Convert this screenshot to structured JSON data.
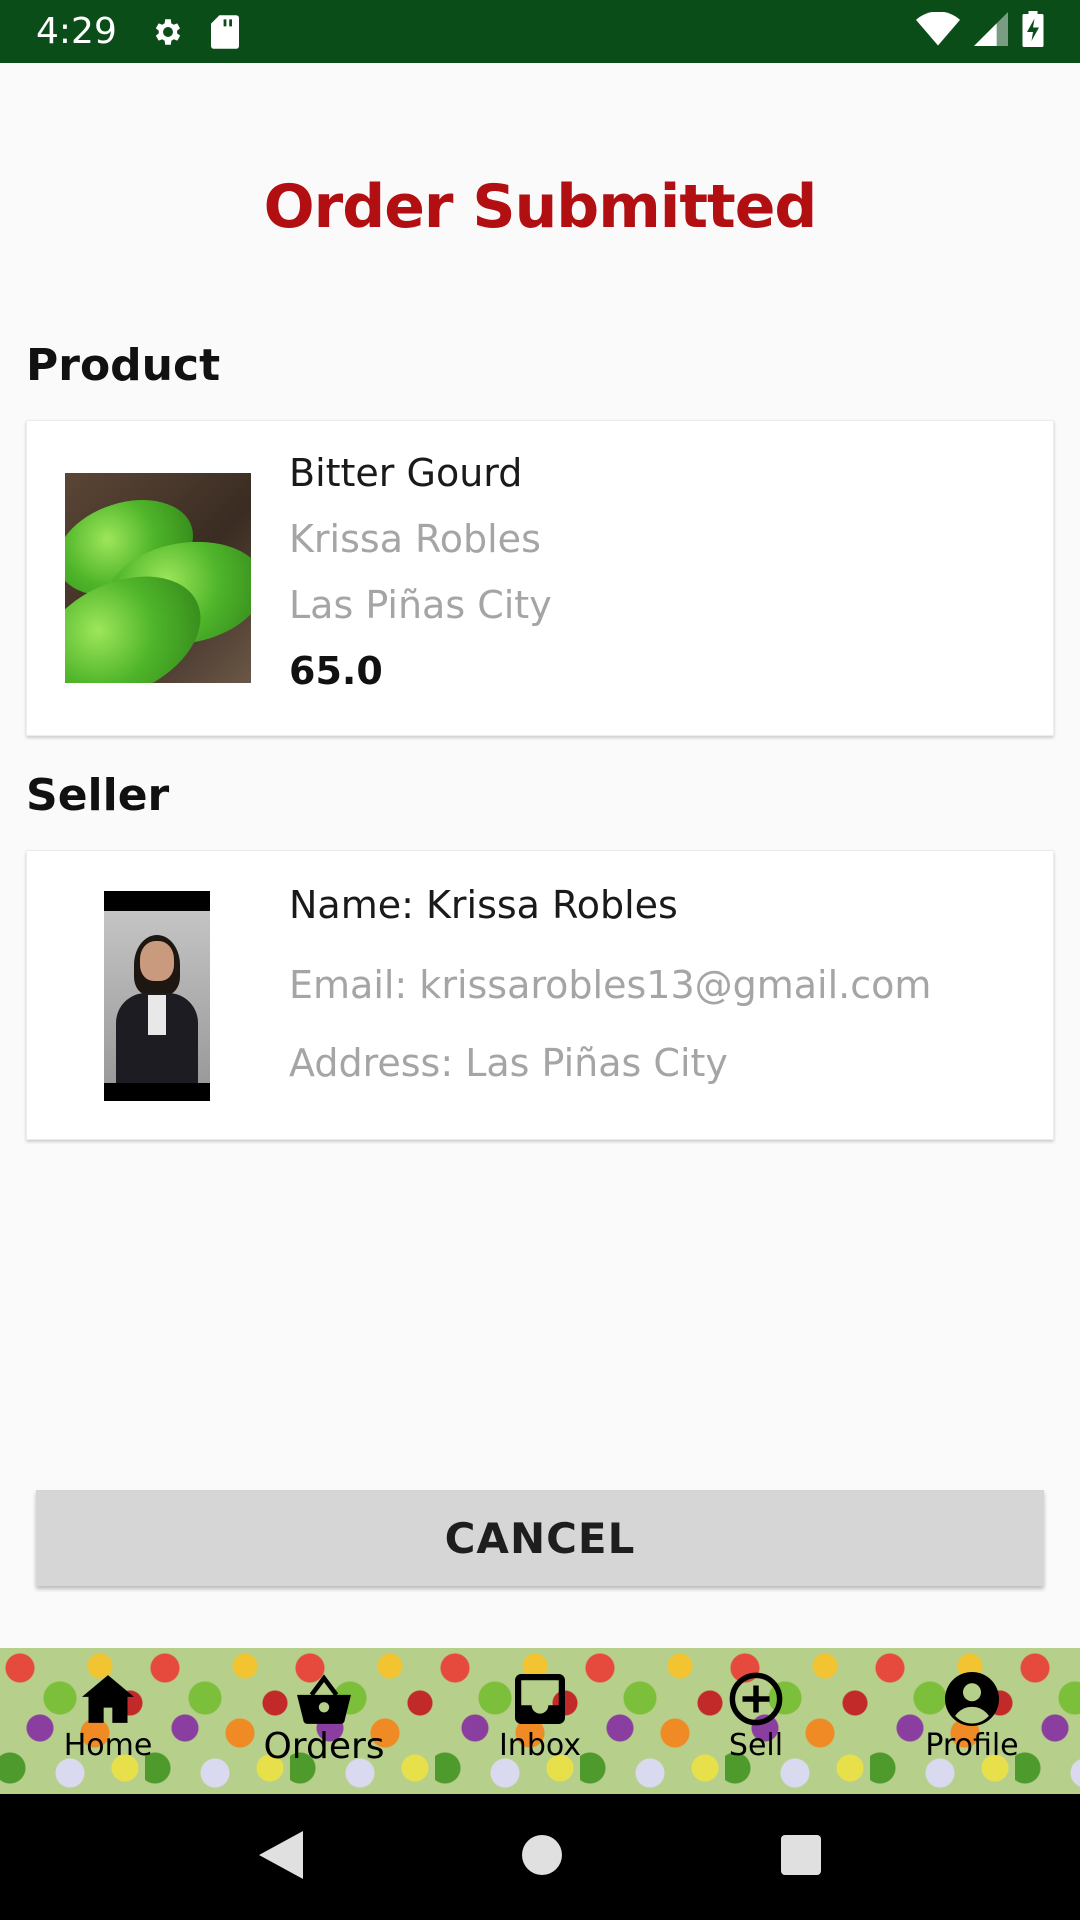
{
  "status_bar": {
    "time": "4:29",
    "left_icons": [
      "gear-icon",
      "sd-card-icon"
    ],
    "right_icons": [
      "wifi-icon",
      "signal-icon",
      "battery-charging-icon"
    ],
    "background": "#0b4d18"
  },
  "page": {
    "title": "Order Submitted",
    "title_color": "#b20f12"
  },
  "product": {
    "heading": "Product",
    "name": "Bitter Gourd",
    "seller": "Krissa Robles",
    "location": "Las Piñas City",
    "price": "65.0"
  },
  "seller": {
    "heading": "Seller",
    "name": "Name: Krissa Robles",
    "email": "Email: krissarobles13@gmail.com",
    "address": "Address: Las Piñas City"
  },
  "actions": {
    "cancel_label": "CANCEL"
  },
  "bottom_nav": {
    "items": [
      {
        "label": "Home",
        "icon": "home-icon"
      },
      {
        "label": "Orders",
        "icon": "basket-icon",
        "active": true
      },
      {
        "label": "Inbox",
        "icon": "inbox-icon"
      },
      {
        "label": "Sell",
        "icon": "add-circle-icon"
      },
      {
        "label": "Profile",
        "icon": "account-circle-icon"
      }
    ]
  },
  "system_nav": {
    "buttons": [
      "back-icon",
      "home-circle-icon",
      "recents-icon"
    ]
  }
}
